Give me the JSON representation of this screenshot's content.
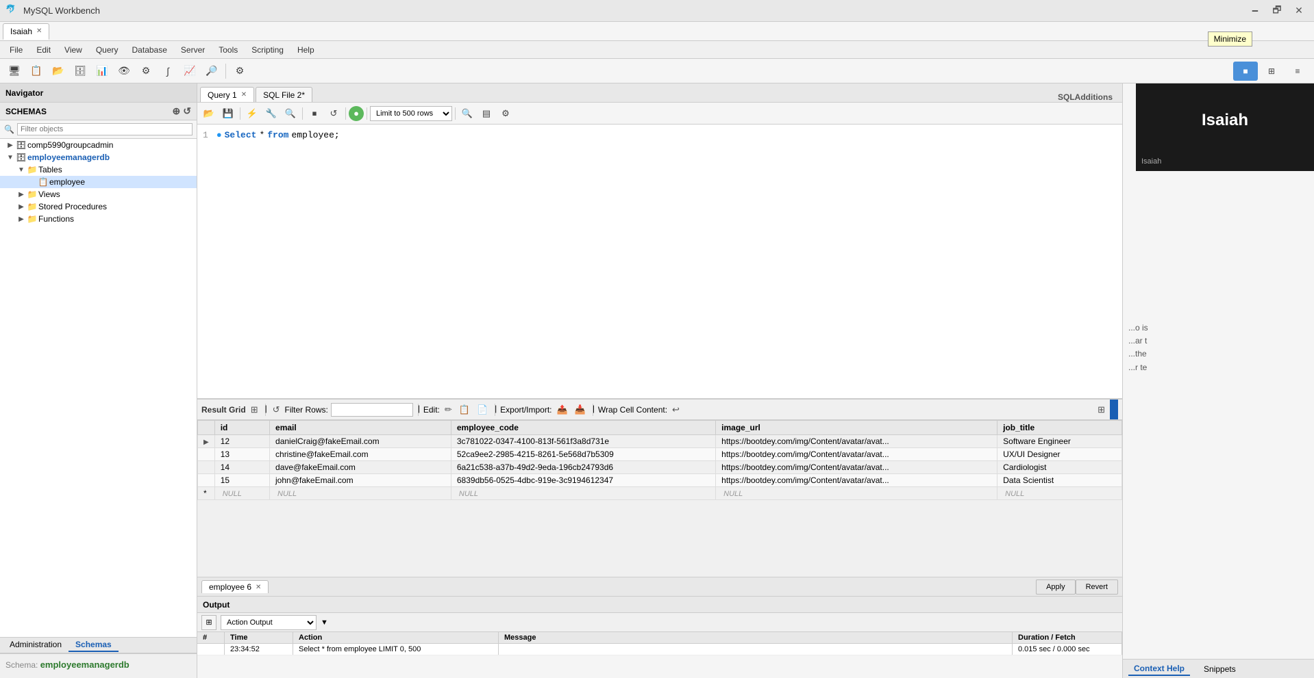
{
  "titleBar": {
    "title": "MySQL Workbench",
    "appIcon": "🐬",
    "minimizeBtn": "🗕",
    "maximizeBtn": "🗗",
    "closeBtn": "✕",
    "minimizeTooltip": "Minimize"
  },
  "mainTab": {
    "label": "Isaiah",
    "closeIcon": "✕"
  },
  "menuBar": {
    "items": [
      "File",
      "Edit",
      "View",
      "Query",
      "Database",
      "Server",
      "Tools",
      "Scripting",
      "Help"
    ]
  },
  "sidebar": {
    "navigatorLabel": "Navigator",
    "schemasLabel": "SCHEMAS",
    "filterPlaceholder": "Filter objects",
    "tree": [
      {
        "level": 0,
        "arrow": "▶",
        "icon": "🗄",
        "label": "comp5990groupcadmin",
        "bold": false
      },
      {
        "level": 0,
        "arrow": "▼",
        "icon": "🗄",
        "label": "employeemanagerdb",
        "bold": true
      },
      {
        "level": 1,
        "arrow": "▼",
        "icon": "📁",
        "label": "Tables",
        "bold": false
      },
      {
        "level": 2,
        "arrow": "",
        "icon": "📋",
        "label": "employee",
        "bold": false
      },
      {
        "level": 1,
        "arrow": "▶",
        "icon": "📁",
        "label": "Views",
        "bold": false
      },
      {
        "level": 1,
        "arrow": "▶",
        "icon": "📁",
        "label": "Stored Procedures",
        "bold": false
      },
      {
        "level": 1,
        "arrow": "▶",
        "icon": "📁",
        "label": "Functions",
        "bold": false
      }
    ],
    "administrationTab": "Administration",
    "schemasTab": "Schemas",
    "schemaInfoTitle": "Schema:",
    "schemaInfoName": "employeemanagerdb"
  },
  "sqlEditor": {
    "tabs": [
      {
        "label": "Query 1",
        "active": true,
        "closable": true
      },
      {
        "label": "SQL File 2*",
        "active": false,
        "closable": false
      }
    ],
    "rightPanel": "SQLAdditions",
    "editorToolbar": {
      "openFolder": "📂",
      "save": "💾",
      "execute": "⚡",
      "executeSelection": "🔧",
      "find": "🔍",
      "stop": "⏹",
      "reconnect": "↺",
      "green": "🟢",
      "record": "⏺",
      "schema": "📊",
      "limitLabel": "Limit to 500 rows",
      "magnify": "🔍",
      "format": "▤",
      "config": "⚙"
    },
    "lineNumber": "1",
    "code": {
      "dot": "●",
      "select": "Select",
      "star": "*",
      "from": "from",
      "table": "employee;"
    }
  },
  "resultGrid": {
    "label": "Result Grid",
    "filterRowsPlaceholder": "Filter Rows:",
    "editLabel": "Edit:",
    "exportImportLabel": "Export/Import:",
    "wrapCellLabel": "Wrap Cell Content:",
    "columns": [
      "",
      "id",
      "email",
      "employee_code",
      "image_url",
      "job_title"
    ],
    "rows": [
      {
        "arrow": "▶",
        "id": "12",
        "email": "danielCraig@fakeEmail.com",
        "employee_code": "3c781022-0347-4100-813f-561f3a8d731e",
        "image_url": "https://bootdey.com/img/Content/avatar/avat...",
        "job_title": "Software Engineer"
      },
      {
        "arrow": "",
        "id": "13",
        "email": "christine@fakeEmail.com",
        "employee_code": "52ca9ee2-2985-4215-8261-5e568d7b5309",
        "image_url": "https://bootdey.com/img/Content/avatar/avat...",
        "job_title": "UX/UI Designer"
      },
      {
        "arrow": "",
        "id": "14",
        "email": "dave@fakeEmail.com",
        "employee_code": "6a21c538-a37b-49d2-9eda-196cb24793d6",
        "image_url": "https://bootdey.com/img/Content/avatar/avat...",
        "job_title": "Cardiologist"
      },
      {
        "arrow": "",
        "id": "15",
        "email": "john@fakeEmail.com",
        "employee_code": "6839db56-0525-4dbc-919e-3c9194612347",
        "image_url": "https://bootdey.com/img/Content/avatar/avat...",
        "job_title": "Data Scientist"
      },
      {
        "arrow": "*",
        "id": "NULL",
        "email": "NULL",
        "employee_code": "NULL",
        "image_url": "NULL",
        "job_title": "NULL"
      }
    ]
  },
  "bottomTabs": {
    "tab1": "employee 6",
    "tab1Close": "✕"
  },
  "actionBar": {
    "applyBtn": "Apply",
    "revertBtn": "Revert"
  },
  "rightBottomTabs": {
    "contextHelp": "Context Help",
    "snippets": "Snippets"
  },
  "output": {
    "header": "Output",
    "actionOutputLabel": "Action Output",
    "dropdownArrow": "▼",
    "tableHeaders": {
      "hash": "#",
      "time": "Time",
      "action": "Action",
      "message": "Message",
      "duration": "Duration / Fetch"
    }
  },
  "isaiahPopup": {
    "name": "Isaiah",
    "smallLabel": "Isaiah"
  }
}
